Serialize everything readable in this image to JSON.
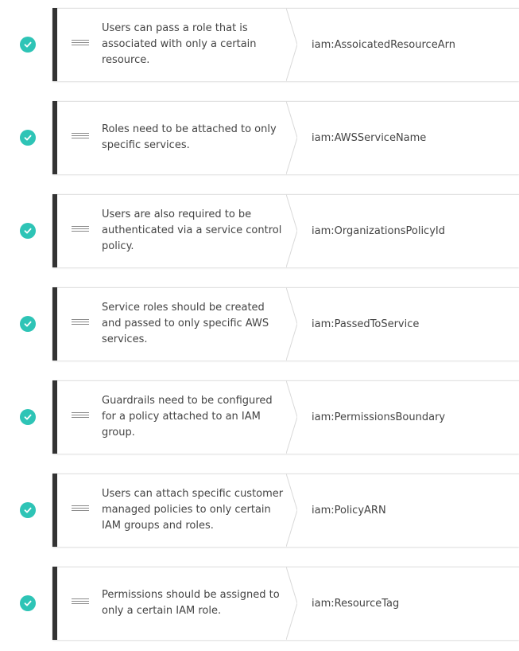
{
  "colors": {
    "check": "#2ec4b6",
    "card_bar": "#333333",
    "text": "#444444"
  },
  "items": [
    {
      "status_icon": "check-circle-icon",
      "description": "Users can pass a role that is associated with only a certain resource.",
      "condition_key": "iam:AssoicatedResourceArn"
    },
    {
      "status_icon": "check-circle-icon",
      "description": "Roles need to be attached to only specific services.",
      "condition_key": "iam:AWSServiceName"
    },
    {
      "status_icon": "check-circle-icon",
      "description": "Users are also required to be authenticated via a service control policy.",
      "condition_key": "iam:OrganizationsPolicyId"
    },
    {
      "status_icon": "check-circle-icon",
      "description": "Service roles should be created and passed to only specific AWS services.",
      "condition_key": "iam:PassedToService"
    },
    {
      "status_icon": "check-circle-icon",
      "description": "Guardrails need to be configured for a policy attached to an IAM group.",
      "condition_key": "iam:PermissionsBoundary"
    },
    {
      "status_icon": "check-circle-icon",
      "description": "Users can attach specific customer managed policies to only certain IAM groups and roles.",
      "condition_key": "iam:PolicyARN"
    },
    {
      "status_icon": "check-circle-icon",
      "description": "Permissions should be assigned to only a certain IAM role.",
      "condition_key": "iam:ResourceTag"
    }
  ]
}
